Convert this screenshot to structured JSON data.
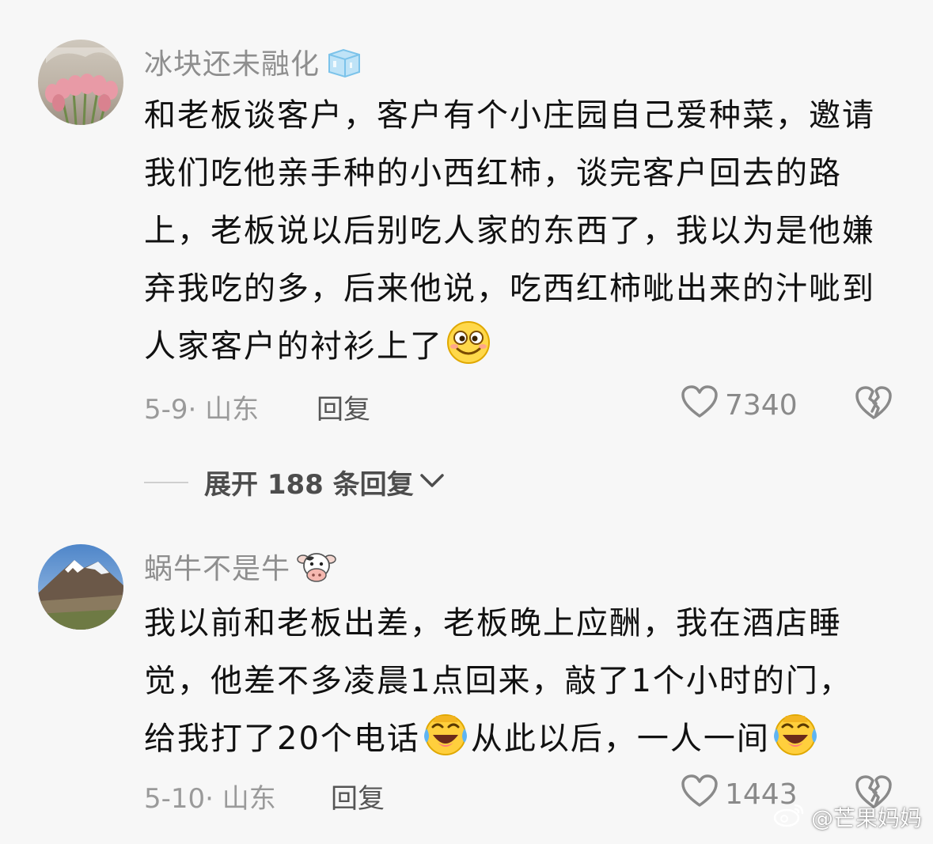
{
  "comments": [
    {
      "username": "冰块还未融化",
      "badge_icon": "ice-cube-icon",
      "text": "和老板谈客户，客户有个小庄园自己爱种菜，邀请我们吃他亲手种的小西红柿，谈完客户回去的路上，老板说以后别吃人家的东西了，我以为是他嫌弃我吃的多，后来他说，吃西红柿呲出来的汁呲到人家客户的衬衫上了",
      "text_emoji": "silly-face-emoji",
      "date_location": "5-9· 山东",
      "reply_label": "回复",
      "likes": "7340"
    },
    {
      "username": "蜗牛不是牛",
      "badge_icon": "cow-face-icon",
      "text_part1": "我以前和老板出差，老板晚上应酬，我在酒店睡觉，他差不多凌晨1点回来，敲了1个小时的门，给我打了20个电话",
      "text_part2": "从此以后，一人一间",
      "text_emoji": "crying-laughing-emoji",
      "date_location": "5-10· 山东",
      "reply_label": "回复",
      "likes": "1443"
    }
  ],
  "expand_replies": {
    "label": "展开 188 条回复"
  },
  "watermark": {
    "text": "@芒果妈妈"
  }
}
